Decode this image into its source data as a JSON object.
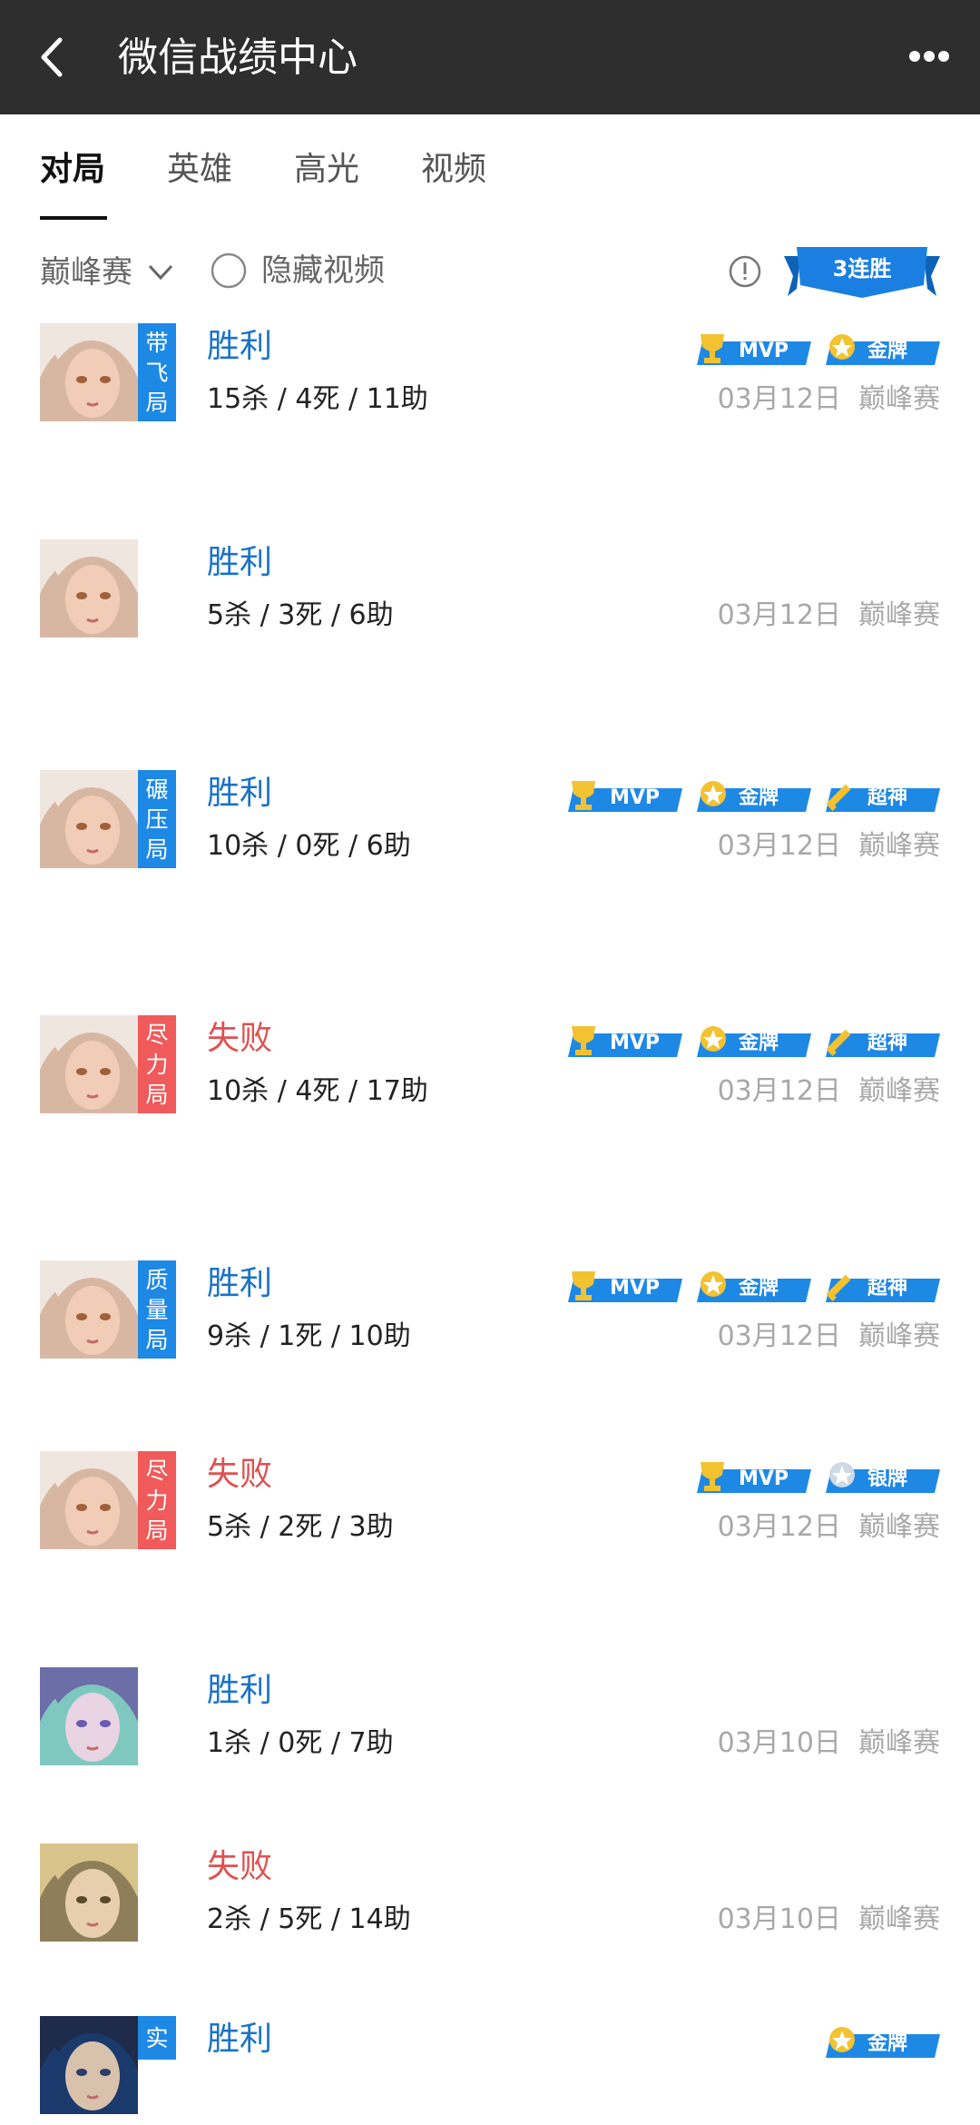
{
  "header": {
    "title": "微信战绩中心"
  },
  "tabs": [
    {
      "label": "对局",
      "active": true
    },
    {
      "label": "英雄",
      "active": false
    },
    {
      "label": "高光",
      "active": false
    },
    {
      "label": "视频",
      "active": false
    }
  ],
  "filter": {
    "mode": "巅峰赛",
    "hide_video": "隐藏视频",
    "streak": "3连胜"
  },
  "colors": {
    "win": "#1a73c8",
    "lose": "#e05050",
    "tag_blue": "#1e88e5",
    "tag_red": "#f05a5a",
    "badge_blue": "#1e88e5",
    "badge_gold": "#f2c230"
  },
  "matches": [
    {
      "result": "胜利",
      "kda": "15杀 / 4死 / 11助",
      "date": "03月12日",
      "mode": "巅峰赛",
      "tag": [
        "带",
        "飞",
        "局"
      ],
      "tag_color": "blue",
      "badges": [
        "MVP",
        "金牌"
      ],
      "hero": "hero-a"
    },
    {
      "result": "胜利",
      "kda": "5杀 / 3死 / 6助",
      "date": "03月12日",
      "mode": "巅峰赛",
      "tag": [],
      "badges": [],
      "hero": "hero-a"
    },
    {
      "result": "胜利",
      "kda": "10杀 / 0死 / 6助",
      "date": "03月12日",
      "mode": "巅峰赛",
      "tag": [
        "碾",
        "压",
        "局"
      ],
      "tag_color": "blue",
      "badges": [
        "MVP",
        "金牌",
        "超神"
      ],
      "hero": "hero-a"
    },
    {
      "result": "失败",
      "kda": "10杀 / 4死 / 17助",
      "date": "03月12日",
      "mode": "巅峰赛",
      "tag": [
        "尽",
        "力",
        "局"
      ],
      "tag_color": "red",
      "badges": [
        "MVP",
        "金牌",
        "超神"
      ],
      "hero": "hero-a"
    },
    {
      "result": "胜利",
      "kda": "9杀 / 1死 / 10助",
      "date": "03月12日",
      "mode": "巅峰赛",
      "tag": [
        "质",
        "量",
        "局"
      ],
      "tag_color": "blue",
      "badges": [
        "MVP",
        "金牌",
        "超神"
      ],
      "hero": "hero-a"
    },
    {
      "result": "失败",
      "kda": "5杀 / 2死 / 3助",
      "date": "03月12日",
      "mode": "巅峰赛",
      "tag": [
        "尽",
        "力",
        "局"
      ],
      "tag_color": "red",
      "badges": [
        "MVP",
        "银牌"
      ],
      "hero": "hero-a"
    },
    {
      "result": "胜利",
      "kda": "1杀 / 0死 / 7助",
      "date": "03月10日",
      "mode": "巅峰赛",
      "tag": [],
      "badges": [],
      "hero": "hero-b"
    },
    {
      "result": "失败",
      "kda": "2杀 / 5死 / 14助",
      "date": "03月10日",
      "mode": "巅峰赛",
      "tag": [],
      "badges": [],
      "hero": "hero-c"
    },
    {
      "result": "胜利",
      "kda": "",
      "date": "",
      "mode": "",
      "tag": [
        "实"
      ],
      "tag_color": "blue",
      "badges": [
        "金牌"
      ],
      "hero": "hero-d"
    }
  ]
}
